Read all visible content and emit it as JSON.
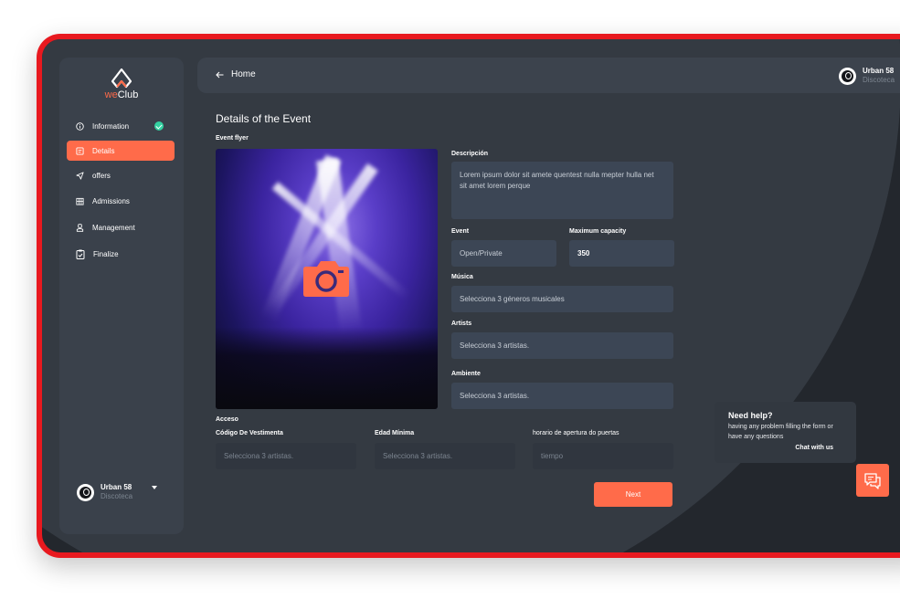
{
  "brand": {
    "prefix": "we",
    "name": "Club"
  },
  "sidebar": {
    "items": [
      {
        "label": "Information",
        "icon": "info-icon",
        "completed": true,
        "active": false
      },
      {
        "label": "Details",
        "icon": "document-icon",
        "completed": false,
        "active": true
      },
      {
        "label": "offers",
        "icon": "send-icon",
        "completed": false,
        "active": false
      },
      {
        "label": "Admissions",
        "icon": "building-icon",
        "completed": false,
        "active": false
      },
      {
        "label": "Management",
        "icon": "user-icon",
        "completed": false,
        "active": false
      },
      {
        "label": "Finalize",
        "icon": "clipboard-check-icon",
        "completed": false,
        "active": false
      }
    ],
    "user": {
      "name": "Urban 58",
      "type": "Discoteca"
    }
  },
  "header": {
    "back_label": "Home",
    "user": {
      "name": "Urban 58",
      "type": "Discoteca"
    }
  },
  "form": {
    "title": "Details of the Event",
    "flyer_label": "Event flyer",
    "description": {
      "label": "Descripción",
      "value": "Lorem ipsum dolor sit amete quentest nulla mepter hulla net sit amet lorem perque"
    },
    "event": {
      "label": "Event",
      "value": "Open/Private"
    },
    "capacity": {
      "label": "Maximum capacity",
      "value": "350"
    },
    "music": {
      "label": "Música",
      "placeholder": "Selecciona 3 géneros musicales"
    },
    "artists": {
      "label": "Artists",
      "placeholder": "Selecciona 3 artistas."
    },
    "ambience": {
      "label": "Ambiente",
      "placeholder": "Selecciona 3 artistas."
    },
    "access": {
      "label": "Acceso",
      "dress_code": {
        "label": "Código De Vestimenta",
        "placeholder": "Selecciona 3 artistas."
      },
      "min_age": {
        "label": "Edad Mínima",
        "placeholder": "Selecciona 3 artistas."
      },
      "door_time": {
        "label": "horario de apertura do puertas",
        "placeholder": "tiempo"
      }
    },
    "next_label": "Next"
  },
  "help": {
    "title": "Need help?",
    "text": "having any problem filling the form or have any questions",
    "link": "Chat with us"
  },
  "colors": {
    "accent": "#ff6b4a",
    "success": "#33d1a1",
    "frame": "#e8191f",
    "background": "#23272d",
    "panel": "#3a414b"
  }
}
